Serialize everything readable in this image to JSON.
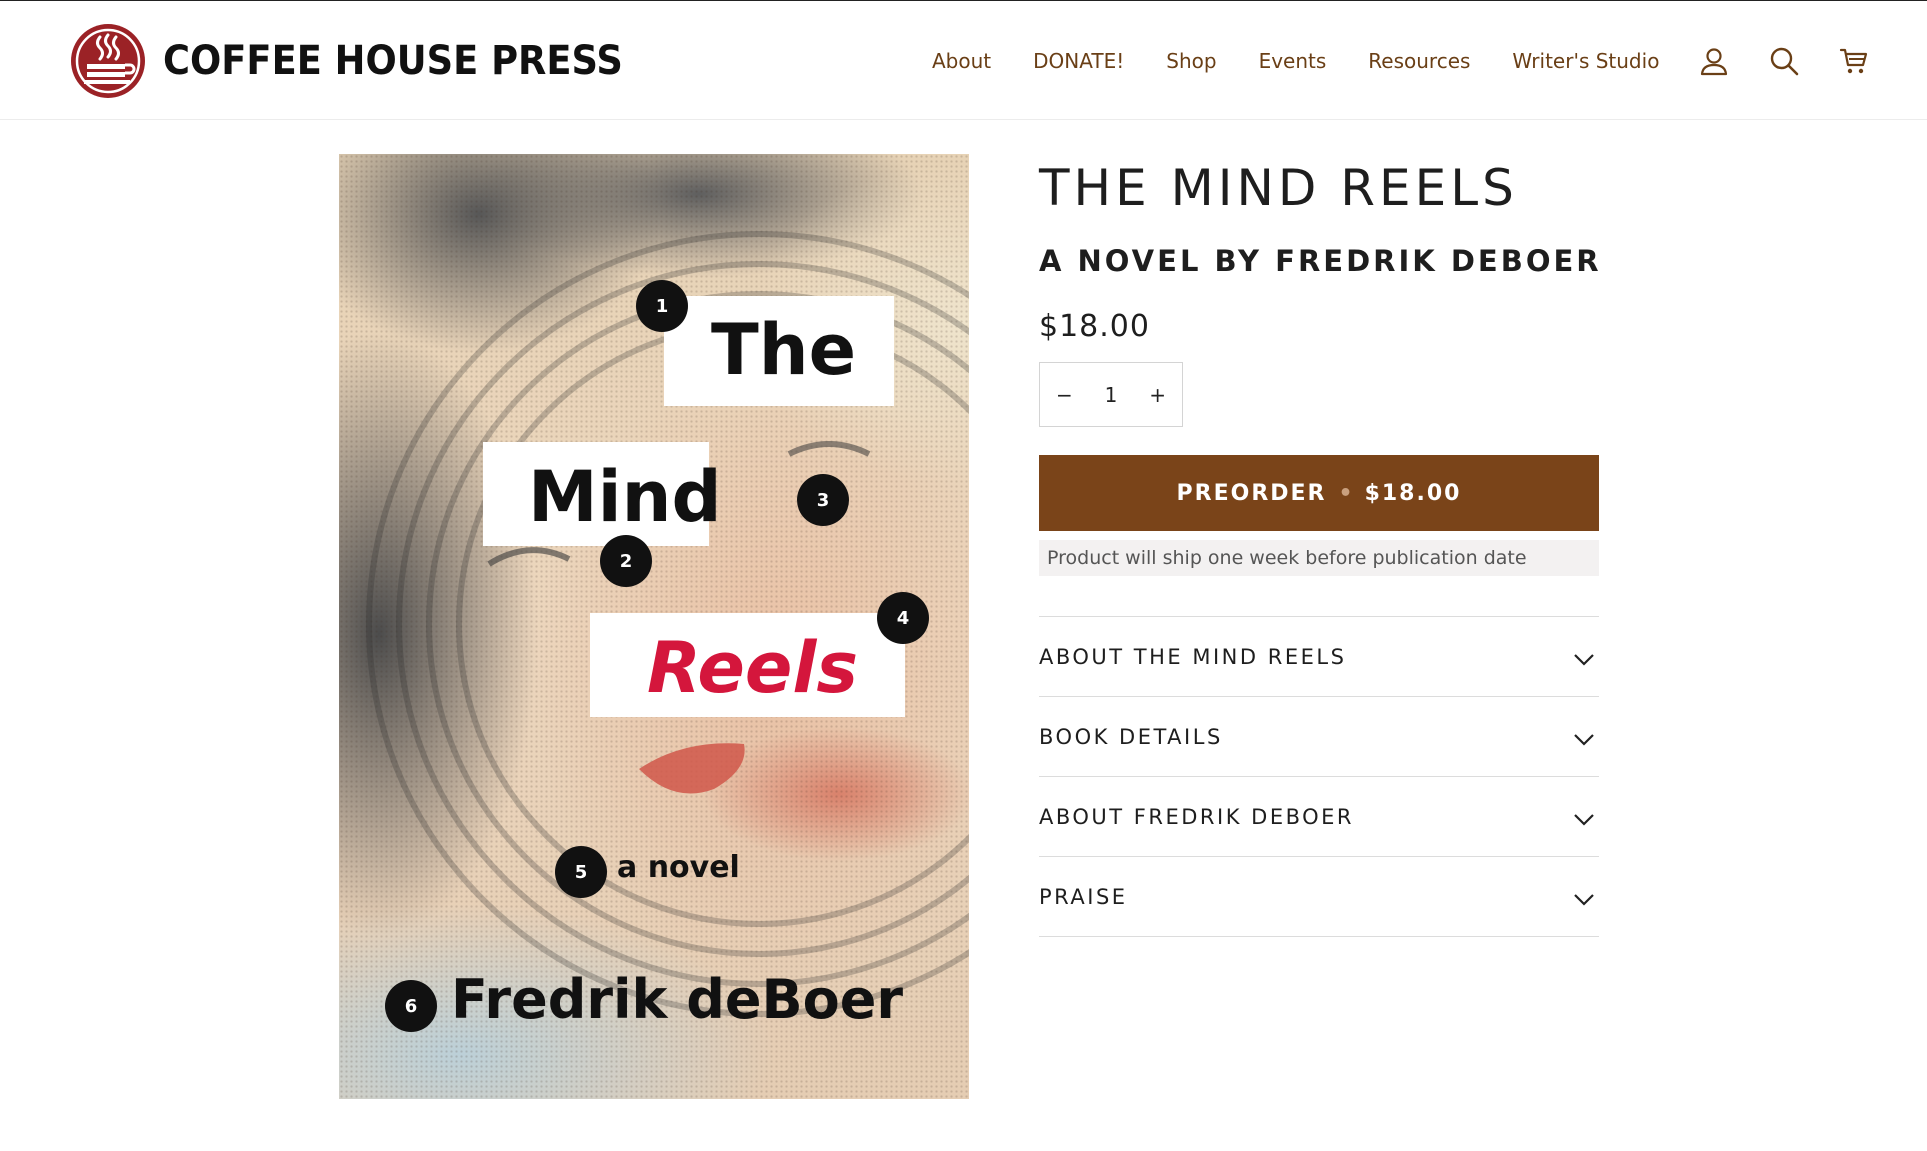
{
  "brand": {
    "name": "COFFEE HOUSE PRESS",
    "logo_icon": "coffee-cup-steam-logo",
    "accent_color": "#9b2226"
  },
  "nav": {
    "items": [
      {
        "label": "About"
      },
      {
        "label": "DONATE!"
      },
      {
        "label": "Shop"
      },
      {
        "label": "Events"
      },
      {
        "label": "Resources"
      },
      {
        "label": "Writer's Studio"
      }
    ],
    "link_color": "#6a3f16",
    "icons": [
      "account-icon",
      "search-icon",
      "cart-icon"
    ]
  },
  "cover": {
    "words": {
      "the": "The",
      "mind": "Mind",
      "reels": "Reels",
      "novel": "a novel",
      "author": "Fredrik deBoer"
    },
    "badges": [
      "1",
      "2",
      "3",
      "4",
      "5",
      "6"
    ],
    "reels_color": "#d4163c"
  },
  "product": {
    "title": "THE MIND REELS",
    "subtitle": "A NOVEL BY FREDRIK DEBOER",
    "price": "$18.00",
    "quantity": {
      "minus": "−",
      "value": "1",
      "plus": "+"
    },
    "preorder": {
      "label": "PREORDER",
      "separator": "•",
      "price": "$18.00",
      "color": "#7a4419"
    },
    "ship_note": "Product will ship one week before publication date",
    "accordion": [
      {
        "label": "ABOUT THE MIND REELS"
      },
      {
        "label": "BOOK DETAILS"
      },
      {
        "label": "ABOUT FREDRIK DEBOER"
      },
      {
        "label": "PRAISE"
      }
    ]
  }
}
